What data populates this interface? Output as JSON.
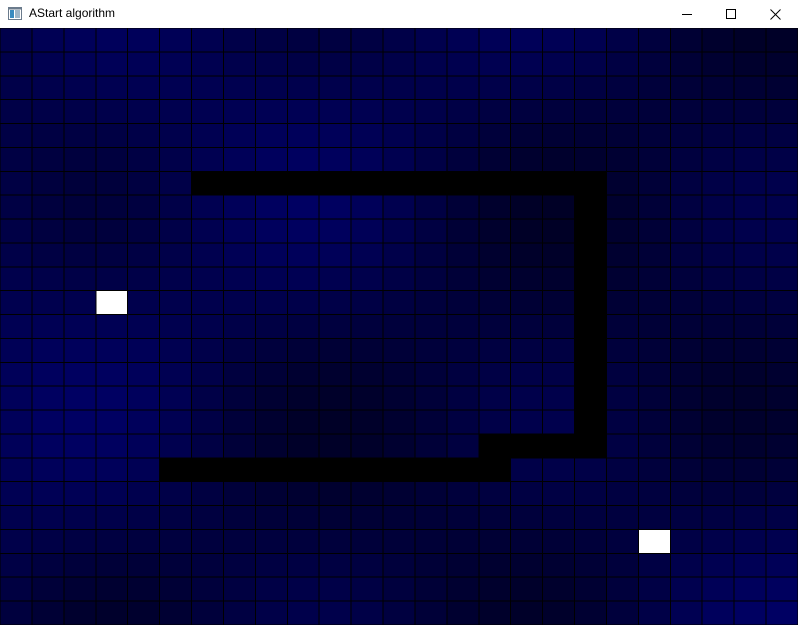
{
  "window": {
    "title": "AStart algorithm",
    "icon": "app-window-icon",
    "controls": {
      "minimize_icon": "minimize-icon",
      "maximize_icon": "maximize-icon",
      "close_icon": "close-icon"
    }
  },
  "grid": {
    "columns": 25,
    "rows": 25,
    "colors": {
      "background_base": "#000010",
      "cell_border": "#000000",
      "wall": "#000000",
      "endpoint": "#ffffff",
      "gradient_dark": "#000018",
      "gradient_light": "#000070"
    },
    "walls": [
      [
        6,
        6
      ],
      [
        7,
        6
      ],
      [
        8,
        6
      ],
      [
        9,
        6
      ],
      [
        10,
        6
      ],
      [
        11,
        6
      ],
      [
        12,
        6
      ],
      [
        13,
        6
      ],
      [
        14,
        6
      ],
      [
        15,
        6
      ],
      [
        16,
        6
      ],
      [
        17,
        6
      ],
      [
        18,
        6
      ],
      [
        18,
        7
      ],
      [
        18,
        8
      ],
      [
        18,
        9
      ],
      [
        18,
        10
      ],
      [
        18,
        11
      ],
      [
        18,
        12
      ],
      [
        18,
        13
      ],
      [
        18,
        14
      ],
      [
        18,
        15
      ],
      [
        18,
        16
      ],
      [
        18,
        17
      ],
      [
        15,
        17
      ],
      [
        16,
        17
      ],
      [
        17,
        17
      ],
      [
        5,
        18
      ],
      [
        6,
        18
      ],
      [
        7,
        18
      ],
      [
        8,
        18
      ],
      [
        9,
        18
      ],
      [
        10,
        18
      ],
      [
        11,
        18
      ],
      [
        12,
        18
      ],
      [
        13,
        18
      ],
      [
        14,
        18
      ],
      [
        15,
        18
      ]
    ],
    "start": [
      3,
      11
    ],
    "goal": [
      20,
      21
    ]
  }
}
